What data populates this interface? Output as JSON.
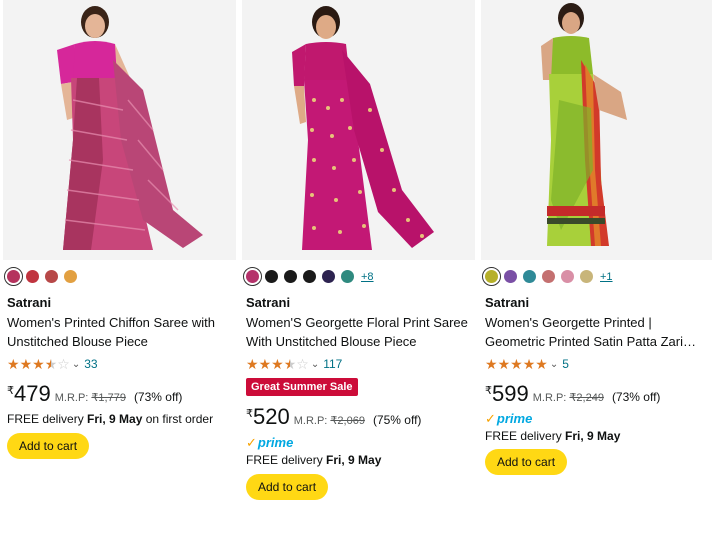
{
  "products": [
    {
      "brand": "Satrani",
      "title_line1": "Women's Printed Chiffon Saree with",
      "title_line2": "Unstitched Blouse Piece",
      "swatches": [
        "#b5335d",
        "#c0343f",
        "#b74848",
        "#e2a041"
      ],
      "more_colors": "",
      "rating": 3.5,
      "review_count": "33",
      "price": "479",
      "currency": "₹",
      "mrp_label": "M.R.P:",
      "mrp": "₹1,779",
      "discount": "(73% off)",
      "deal_badge": "",
      "prime": false,
      "delivery_prefix": "FREE delivery ",
      "delivery_date": "Fri, 9 May",
      "delivery_suffix": " on first order",
      "cart_label": "Add to cart"
    },
    {
      "brand": "Satrani",
      "title_line1": "Women'S Georgette Floral Print Saree",
      "title_line2": "With Unstitched Blouse Piece",
      "swatches": [
        "#b5336b",
        "#1a1a1a",
        "#1a1a1a",
        "#1a1a1a",
        "#2d2350",
        "#2f8a7f"
      ],
      "more_colors": "+8",
      "rating": 3.5,
      "review_count": "117",
      "price": "520",
      "currency": "₹",
      "mrp_label": "M.R.P:",
      "mrp": "₹2,069",
      "discount": "(75% off)",
      "deal_badge": "Great Summer Sale",
      "prime": true,
      "prime_label": "prime",
      "delivery_prefix": "FREE delivery ",
      "delivery_date": "Fri, 9 May",
      "delivery_suffix": "",
      "cart_label": "Add to cart"
    },
    {
      "brand": "Satrani",
      "title_line1": "Women's Georgette Printed |",
      "title_line2": "Geometric Printed Satin Patta Zari…",
      "swatches": [
        "#b6b02a",
        "#7a4fa5",
        "#2f8a97",
        "#c47070",
        "#d98fa6",
        "#c8b57a"
      ],
      "more_colors": "+1",
      "rating": 5,
      "review_count": "5",
      "price": "599",
      "currency": "₹",
      "mrp_label": "M.R.P:",
      "mrp": "₹2,249",
      "discount": "(73% off)",
      "deal_badge": "",
      "prime": true,
      "prime_label": "prime",
      "delivery_prefix": "FREE delivery ",
      "delivery_date": "Fri, 9 May",
      "delivery_suffix": "",
      "cart_label": "Add to cart"
    }
  ],
  "colors": {
    "star": "#de7921",
    "link": "#007185",
    "cart_button": "#ffd814",
    "deal_badge": "#cc0c39",
    "prime": "#00a8e1"
  },
  "icons": [
    "saree-image",
    "star-icon",
    "chevron-down-icon",
    "prime-check-icon"
  ]
}
